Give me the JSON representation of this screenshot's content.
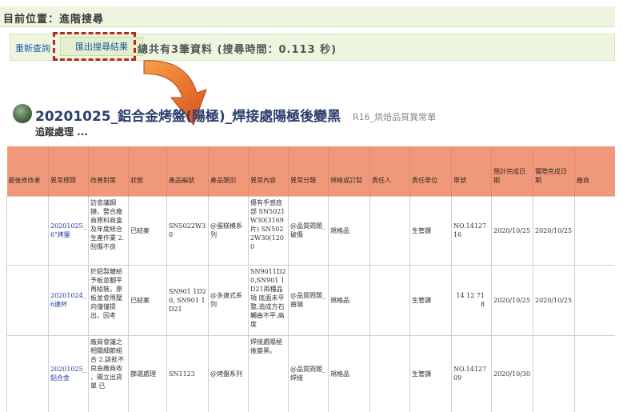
{
  "breadcrumb": "目前位置：進階搜尋",
  "toolbar": {
    "reset_label": "重新查詢",
    "export_label": "匯出搜尋結果",
    "summary": "總共有3筆資料 (搜尋時間：0.113 秒)"
  },
  "case": {
    "title": "20201025_鋁合金烤盤(陽極)_焊接處陽極後變黑",
    "category": "R16_烘焙品質異常單",
    "status": "追蹤處理 ..."
  },
  "table": {
    "headers": [
      "最後修改者",
      "異常標題",
      "改善對策",
      "狀態",
      "產品編號",
      "產品類別",
      "異常內容",
      "異常分類",
      "規格或訂製",
      "責任人",
      "責任單位",
      "單號",
      "預計完成日期",
      "實際完成日期",
      "廠商"
    ],
    "rows": [
      {
        "title": "20201025_6\"烤盤",
        "measure": "訪會議鋼鏈，整合廠商原料商盒及年度統合生產作業 2.刮傷不良",
        "status": "已結案",
        "product_no": "SN5022W30",
        "product_cat": "@蛋糕模系列",
        "content": "傷有手感底部 SN5021W30(3169片) SN5022W30(1200",
        "anomaly_cat": "@品質問題_破傷",
        "spec": "規格品",
        "owner": "",
        "unit": "生管課",
        "number": "NO.1412716",
        "planned": "2020/10/25",
        "actual": "2020/10/25",
        "vendor": ""
      },
      {
        "title": "20201024_6連杯",
        "measure": "於鋁製鍍給予板並翻平再組裝，原板並會用壓向僅僅提出，因考",
        "status": "已結案",
        "product_no": "SN901 1D20, SN901 1D21",
        "product_cat": "@多連式系列",
        "content": "SN9011D20,SN901 1D21兩種品項 底面未平整,造成方石觸曲不平,高度",
        "anomaly_cat": "@品質問題_齒端",
        "spec": "規格品",
        "owner": "",
        "unit": "生管課",
        "number": "14 12 71 8",
        "planned": "2020/10/25",
        "actual": "2020/10/25",
        "vendor": ""
      },
      {
        "title": "20201025_鋁合金",
        "measure": "廠商會議之相關細節組合 2.該批不良由廠商收 ，開立出貨單 已",
        "status": "篩選處理",
        "product_no": "SN1123",
        "product_cat": "@烤盤系列",
        "content": "焊接處陽極後變黑。",
        "anomaly_cat": "@品質問題_焊接",
        "spec": "規格品",
        "owner": "",
        "unit": "生管課",
        "number": "NO.1412709",
        "planned": "2020/10/30",
        "actual": "",
        "vendor": ""
      }
    ]
  }
}
